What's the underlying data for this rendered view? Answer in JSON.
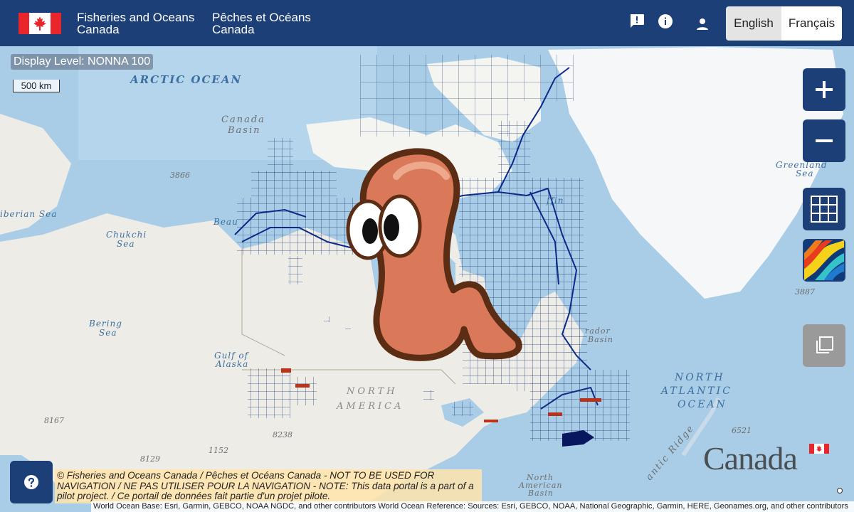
{
  "header": {
    "org_en_line1": "Fisheries and Oceans",
    "org_en_line2": "Canada",
    "org_fr_line1": "Pêches et Océans",
    "org_fr_line2": "Canada",
    "feedback_icon": "feedback-icon",
    "info_icon": "info-icon",
    "account_icon": "account-icon",
    "lang_en": "English",
    "lang_fr": "Français"
  },
  "map": {
    "display_level": "Display Level: NONNA 100",
    "scale": "500 km",
    "labels": {
      "arctic_ocean": "ARCTIC OCEAN",
      "canada_basin_1": "Canada",
      "canada_basin_2": "Basin",
      "depth_3866": "3866",
      "siberian_sea": "iberian Sea",
      "chukchi_1": "Chukchi",
      "chukchi_2": "Sea",
      "beaufort": "Beau",
      "bering_1": "Bering",
      "bering_2": "Sea",
      "alaska_1": "Gulf of",
      "alaska_2": "Alaska",
      "north_america_1": "NORTH",
      "north_america_2": "AMERICA",
      "depth_8167": "8167",
      "depth_8238": "8238",
      "depth_8129": "8129",
      "depth_1152": "1152",
      "greenland_1": "Greenland",
      "greenland_2": "Sea",
      "depth_3887": "3887",
      "north_atlantic_1": "NORTH",
      "north_atlantic_2": "ATLANTIC",
      "north_atlantic_3": "OCEAN",
      "depth_6521": "6521",
      "na_basin_1": "North",
      "na_basin_2": "American",
      "na_basin_3": "Basin",
      "labrador_1": "rador",
      "labrador_2": "Basin",
      "ridge": "antic Ridge",
      "baffin": "ffin"
    }
  },
  "controls": {
    "zoom_in_icon": "plus-icon",
    "zoom_out_icon": "minus-icon",
    "grid_icon": "grid-icon",
    "bathymetry_icon": "bathymetry-layer-icon",
    "layers_icon": "copy-layers-icon"
  },
  "footer": {
    "help_icon": "help-icon",
    "disclaimer": "© Fisheries and Oceans Canada / Pêches et Océans Canada - NOT TO BE USED FOR NAVIGATION / NE PAS UTILISER POUR LA NAVIGATION - NOTE: This data portal is a part of a pilot project. / Ce portail de données fait partie d'un projet pilote.",
    "attribution": "World Ocean Base: Esri, Garmin, GEBCO, NOAA NGDC, and other contributors World Ocean Reference: Sources: Esri, GEBCO, NOAA, National Geographic, Garmin, HERE, Geonames.org, and other contributors",
    "wordmark": "Canada"
  },
  "colors": {
    "header_bg": "#1d3f78",
    "ocean": "#a9cde6",
    "land": "#eeece6",
    "ice": "#f6f7f8",
    "grid": "#24417a",
    "soundings": "#0b2a8a",
    "disclaimer_bg": "#ffe4aa"
  }
}
